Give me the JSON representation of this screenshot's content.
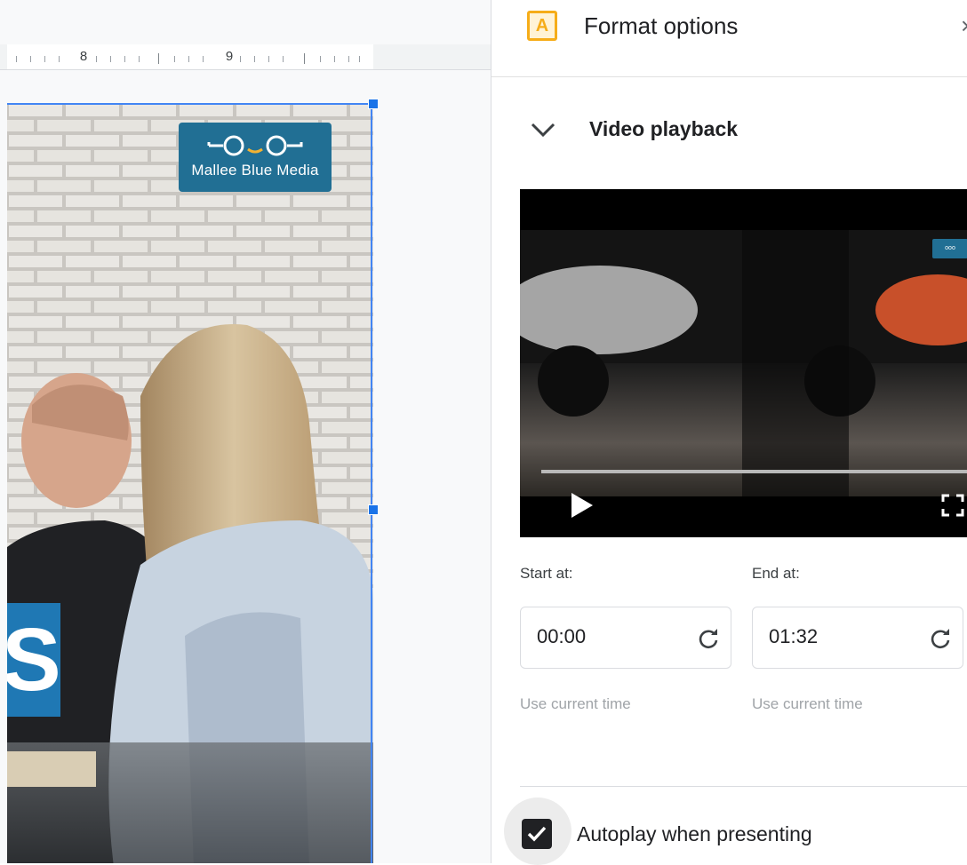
{
  "ruler": {
    "labels": [
      "8",
      "9"
    ]
  },
  "slide": {
    "logo_text": "Mallee Blue Media",
    "badge_letter": "S"
  },
  "panel": {
    "title": "Format options",
    "close_icon": "close-icon",
    "section": {
      "title": "Video playback",
      "icon": "chevron-down-icon"
    },
    "video": {
      "play_icon": "play-icon",
      "fullscreen_icon": "fullscreen-icon",
      "progress": 0
    },
    "start": {
      "label": "Start at:",
      "value": "00:00",
      "hint": "Use current time"
    },
    "end": {
      "label": "End at:",
      "value": "01:32",
      "hint": "Use current time"
    },
    "autoplay": {
      "label": "Autoplay when presenting",
      "checked": true
    }
  },
  "colors": {
    "accent": "#1a73e8",
    "format_icon": "#f6ad19",
    "logo_bg": "#216f94"
  }
}
